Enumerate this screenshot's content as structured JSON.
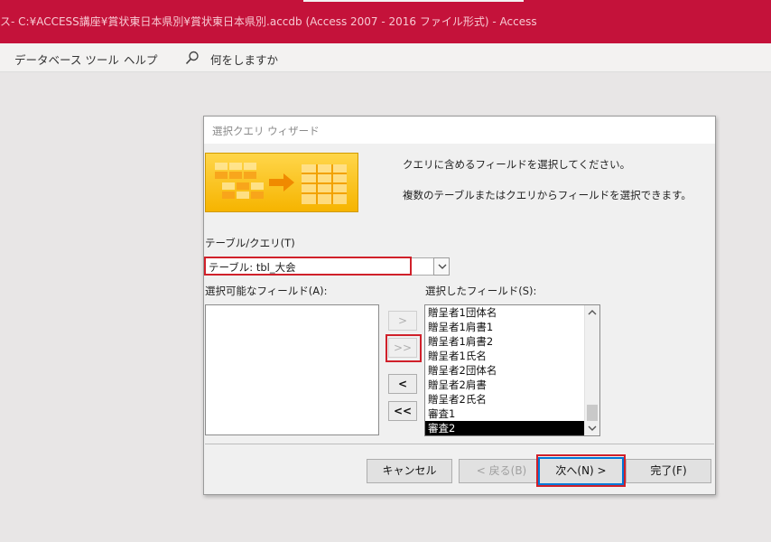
{
  "window": {
    "title": "ス- C:¥ACCESS講座¥賞状東日本県別¥賞状東日本県別.accdb (Access 2007 - 2016 ファイル形式)  -  Access"
  },
  "ribbon": {
    "tabs": [
      "データベース ツール",
      "ヘルプ"
    ],
    "search_icon": "search-icon",
    "search_text": "何をしますか"
  },
  "dialog": {
    "title": "選択クエリ ウィザード",
    "instruction_1": "クエリに含めるフィールドを選択してください。",
    "instruction_2": "複数のテーブルまたはクエリからフィールドを選択できます。",
    "table_query_label": "テーブル/クエリ(T)",
    "table_query_value": "テーブル: tbl_大会",
    "available_fields_label": "選択可能なフィールド(A):",
    "available_fields": [],
    "selected_fields_label": "選択したフィールド(S):",
    "selected_fields": [
      "贈呈者1団体名",
      "贈呈者1肩書1",
      "贈呈者1肩書2",
      "贈呈者1氏名",
      "贈呈者2団体名",
      "贈呈者2肩書",
      "贈呈者2氏名",
      "審査1",
      "審査2"
    ],
    "selected_active_item": "審査2",
    "move_buttons": {
      "add_one": ">",
      "add_all": ">>",
      "remove_one": "<",
      "remove_all": "<<"
    },
    "footer_buttons": {
      "cancel": "キャンセル",
      "back": "< 戻る(B)",
      "next": "次へ(N) >",
      "finish": "完了(F)"
    }
  },
  "colors": {
    "titlebar": "#c4123a",
    "highlight": "#d0202a",
    "focus": "#0078d7"
  }
}
